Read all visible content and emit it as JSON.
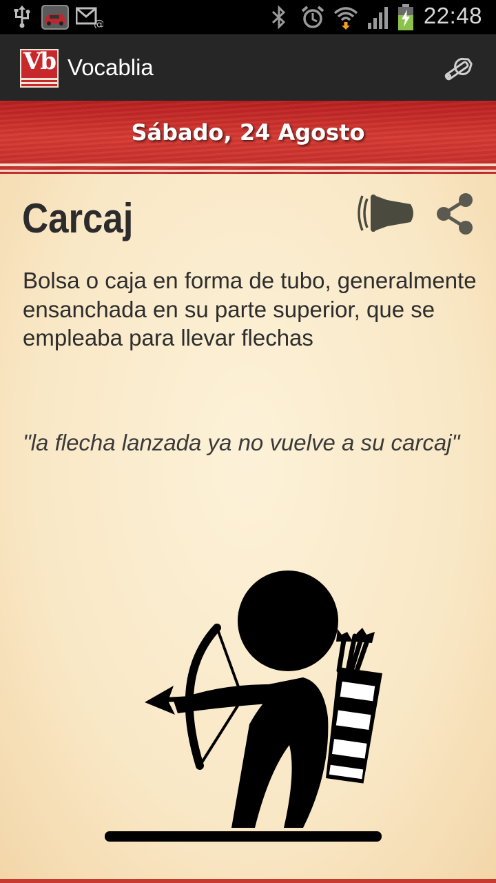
{
  "status_bar": {
    "time": "22:48",
    "icons": [
      "usb-icon",
      "car-app-icon",
      "email-icon",
      "bluetooth-icon",
      "alarm-icon",
      "wifi-icon",
      "signal-icon",
      "battery-charging-icon"
    ]
  },
  "action_bar": {
    "logo_text": "Vb",
    "title": "Vocablia",
    "settings_icon": "wrench-icon"
  },
  "date_banner": {
    "text": "Sábado, 24 Agosto"
  },
  "word": {
    "title": "Carcaj",
    "definition": "Bolsa o caja en forma de tubo, generalmente ensanchada en su parte superior, que se empleaba para llevar flechas",
    "example": "\"la flecha lanzada ya no vuelve a su carcaj\"",
    "icons": [
      "speaker-icon",
      "share-icon"
    ]
  },
  "colors": {
    "banner_red": "#c42c2a",
    "action_bar": "#262626",
    "paper": "#f9e8c6",
    "text": "#2c2c2c"
  }
}
